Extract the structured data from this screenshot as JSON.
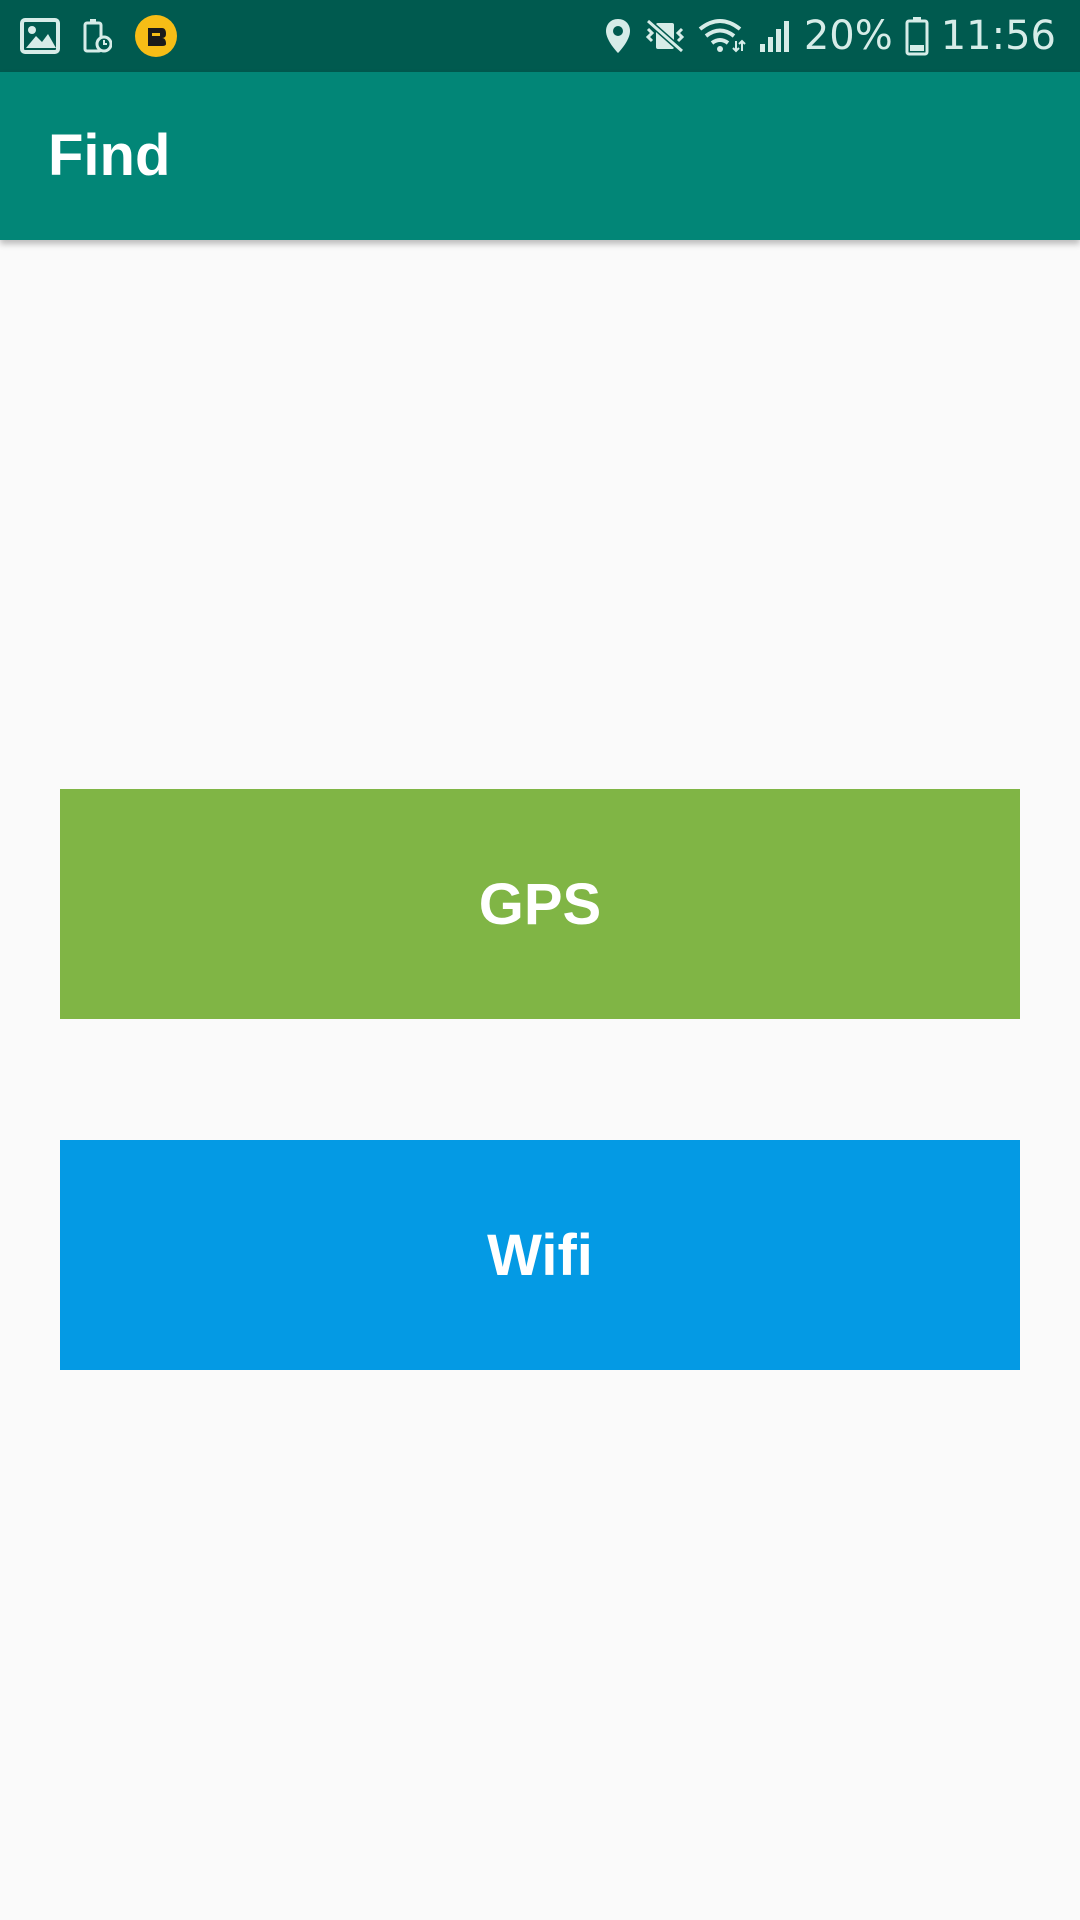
{
  "status_bar": {
    "battery_percent": "20%",
    "time": "11:56",
    "icons": [
      "gallery-icon",
      "battery-saver-icon",
      "app-badge-icon",
      "location-icon",
      "vibrate-mute-icon",
      "wifi-icon",
      "signal-icon",
      "battery-icon"
    ]
  },
  "app_bar": {
    "title": "Find"
  },
  "buttons": {
    "gps_label": "GPS",
    "wifi_label": "Wifi"
  },
  "colors": {
    "status_bar": "#005a4f",
    "app_bar": "#028677",
    "gps_button": "#80b545",
    "wifi_button": "#049ae4",
    "background": "#fafafa",
    "badge": "#f6bd16"
  }
}
